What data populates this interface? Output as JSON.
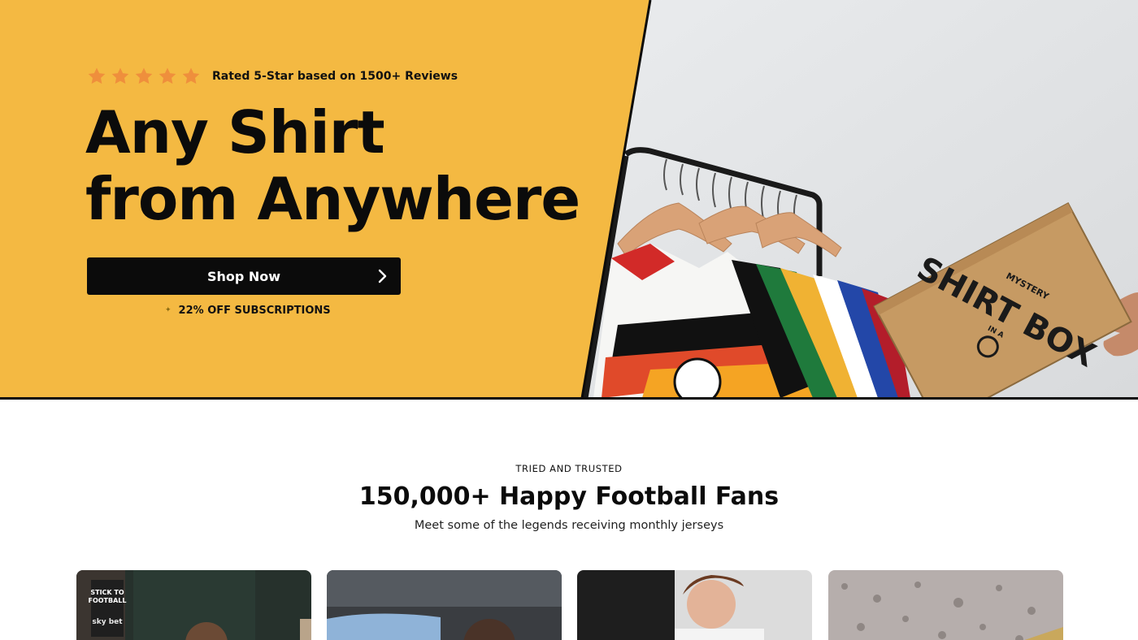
{
  "hero": {
    "rating": {
      "star_count": 5,
      "star_color": "#ef8f3c",
      "text": "Rated 5-Star based on 1500+ Reviews"
    },
    "headline_line1": "Any Shirt",
    "headline_line2": "from Anywhere",
    "cta_label": "Shop Now",
    "cta_icon": "chevron-right-icon",
    "promo_text": "22% OFF SUBSCRIPTIONS",
    "promo_icon": "sparkle-icon",
    "background_color": "#f4b942",
    "box_text": "SHIRT BOX",
    "box_text_small": "MYSTERY",
    "box_text_in_a": "IN A"
  },
  "trust": {
    "eyebrow": "TRIED AND TRUSTED",
    "title": "150,000+ Happy Football Fans",
    "subtitle": "Meet some of the legends receiving monthly jerseys"
  },
  "cards": {
    "card1_badge_line1": "STICK TO",
    "card1_badge_line2": "FOOTBALL",
    "card1_sponsor": "sky bet"
  }
}
